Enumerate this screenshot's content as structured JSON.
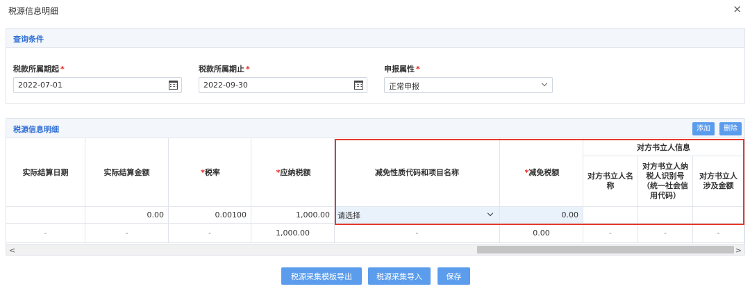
{
  "dialog": {
    "title": "税源信息明细",
    "close_glyph": "×"
  },
  "query": {
    "section_title": "查询条件",
    "start": {
      "label": "税款所属期起",
      "required": "*",
      "value": "2022-07-01"
    },
    "end": {
      "label": "税款所属期止",
      "required": "*",
      "value": "2022-09-30"
    },
    "attr": {
      "label": "申报属性",
      "required": "*",
      "value": "正常申报"
    }
  },
  "detail": {
    "section_title": "税源信息明细",
    "add_label": "添加",
    "delete_label": "删除",
    "headers": {
      "settle_date": "实际结算日期",
      "settle_amount": "实际结算金额",
      "tax_rate": "税率",
      "tax_due": "应纳税额",
      "exempt_code": "减免性质代码和项目名称",
      "exempt_amount": "减免税额",
      "counterparty_group": "对方书立人信息",
      "cp_name": "对方书立人名称",
      "cp_id": "对方书立人纳税人识别号（统一社会信用代码）",
      "cp_amount": "对方书立人涉及金额"
    },
    "required_mark": "*",
    "row": {
      "settle_date": "",
      "settle_amount": "0.00",
      "tax_rate": "0.00100",
      "tax_due": "1,000.00",
      "exempt_select": "请选择",
      "exempt_amount": "0.00",
      "cp_name": "",
      "cp_id": "",
      "cp_amount": ""
    },
    "total_row": {
      "settle_date": "-",
      "settle_amount": "-",
      "tax_rate": "-",
      "tax_due": "1,000.00",
      "exempt_code": "-",
      "exempt_amount": "0.00",
      "cp_name": "-",
      "cp_id": "-",
      "cp_amount": "-"
    },
    "scroll_left": "<",
    "scroll_right": ">"
  },
  "footer": {
    "export_label": "税源采集模板导出",
    "import_label": "税源采集导入",
    "save_label": "保存"
  },
  "colors": {
    "accent": "#5b9cec",
    "required": "#e2231a",
    "highlight": "#e53a2b"
  }
}
